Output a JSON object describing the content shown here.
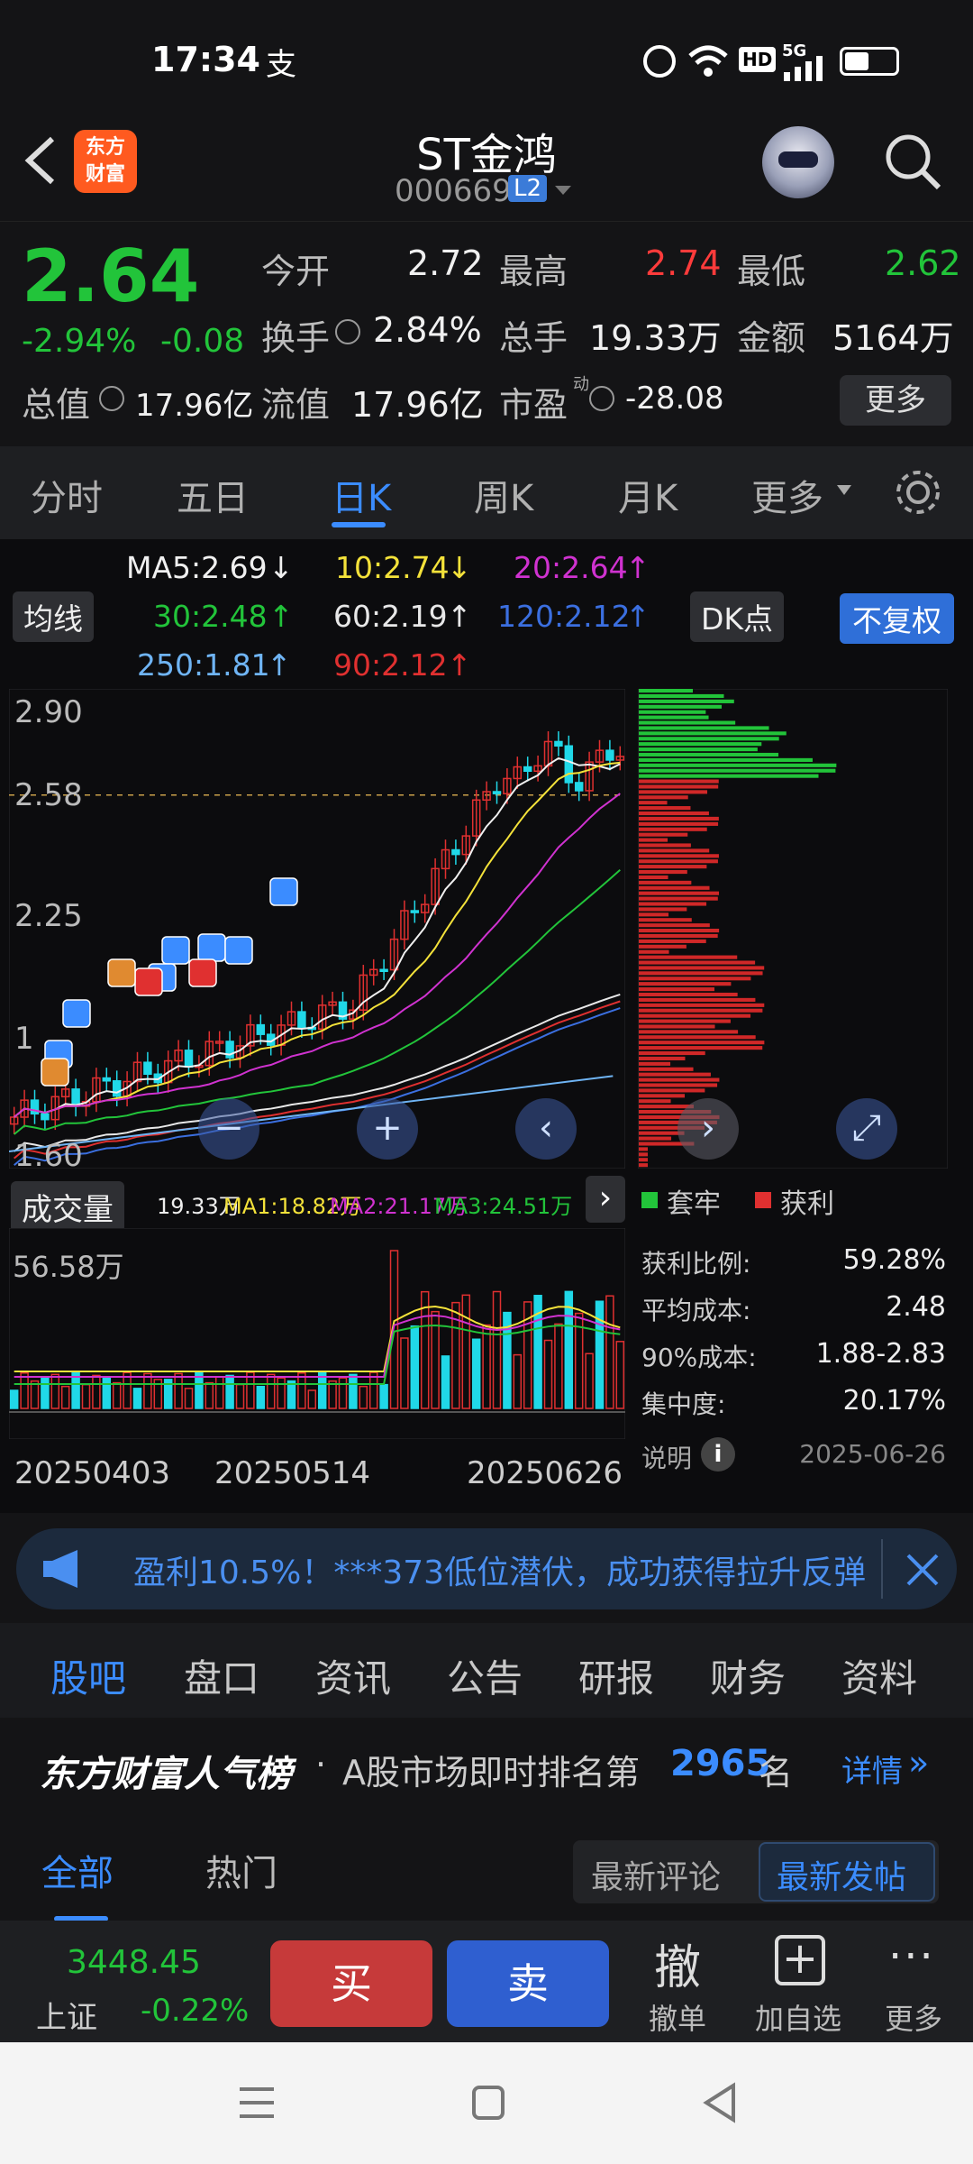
{
  "status": {
    "time": "17:34",
    "alipay_glyph": "支",
    "hd": "HD",
    "network": "5G"
  },
  "header": {
    "title": "ST金鸿",
    "code": "000669",
    "level": "L2",
    "logo_line1": "东方",
    "logo_line2": "财富"
  },
  "quote": {
    "price": "2.64",
    "change_pct": "-2.94%",
    "change": "-0.08",
    "open_label": "今开",
    "open": "2.72",
    "high_label": "最高",
    "high": "2.74",
    "low_label": "最低",
    "low": "2.62",
    "turnover_label": "换手",
    "turnover": "2.84%",
    "volume_label": "总手",
    "volume": "19.33万",
    "amount_label": "金额",
    "amount": "5164万",
    "mktcap_label": "总值",
    "mktcap": "17.96亿",
    "float_label": "流值",
    "float": "17.96亿",
    "pe_label": "市盈",
    "pe_sup": "动",
    "pe": "-28.08",
    "more": "更多"
  },
  "tabs": [
    "分时",
    "五日",
    "日K",
    "周K",
    "月K",
    "更多"
  ],
  "ma": {
    "ma5": "MA5:2.69",
    "ma10": "10:2.74",
    "ma20": "20:2.64",
    "ma30": "30:2.48",
    "ma60": "60:2.19",
    "ma120": "120:2.12",
    "ma250": "250:1.81",
    "ma90": "90:2.12",
    "junxian": "均线",
    "dk": "DK点",
    "fuquan": "不复权"
  },
  "price_axis": {
    "p1": "2.90",
    "p2": "2.58",
    "p3": "2.25",
    "p4": "1",
    "p5": "1.60"
  },
  "volume": {
    "label": "成交量",
    "vol": "19.33万",
    "ma1": "MA1:18.82万",
    "ma2": "MA2:21.17万",
    "ma3": "MA3:24.51万",
    "max": "56.58万",
    "dates": [
      "20250403",
      "20250514",
      "20250626"
    ]
  },
  "chip": {
    "legend_trapped": "套牢",
    "legend_profit": "获利",
    "rows": [
      {
        "label": "获利比例:",
        "value": "59.28%"
      },
      {
        "label": "平均成本:",
        "value": "2.48"
      },
      {
        "label": "90%成本:",
        "value": "1.88-2.83"
      },
      {
        "label": "集中度:",
        "value": "20.17%"
      }
    ],
    "note_label": "说明",
    "date": "2025-06-26"
  },
  "ad": {
    "text": "盈利10.5%！***373低位潜伏，成功获得拉升反弹"
  },
  "bottom_tabs": [
    "股吧",
    "盘口",
    "资讯",
    "公告",
    "研报",
    "财务",
    "资料"
  ],
  "rank": {
    "brand": "东方财富人气榜",
    "dot": "·",
    "text": "A股市场即时排名第",
    "num": "2965",
    "unit": "名",
    "detail": "详情"
  },
  "subtabs": {
    "all": "全部",
    "hot": "热门",
    "latest_comment": "最新评论",
    "latest_post": "最新发帖"
  },
  "trade": {
    "index_value": "3448.45",
    "index_name": "上证",
    "index_change": "-0.22%",
    "buy": "买",
    "sell": "卖",
    "cancel_icon": "撤",
    "cancel": "撤单",
    "add": "加自选",
    "more": "更多"
  },
  "colors": {
    "up": "#ff3b3b",
    "down": "#22c43a",
    "accent": "#3b8cff"
  }
}
